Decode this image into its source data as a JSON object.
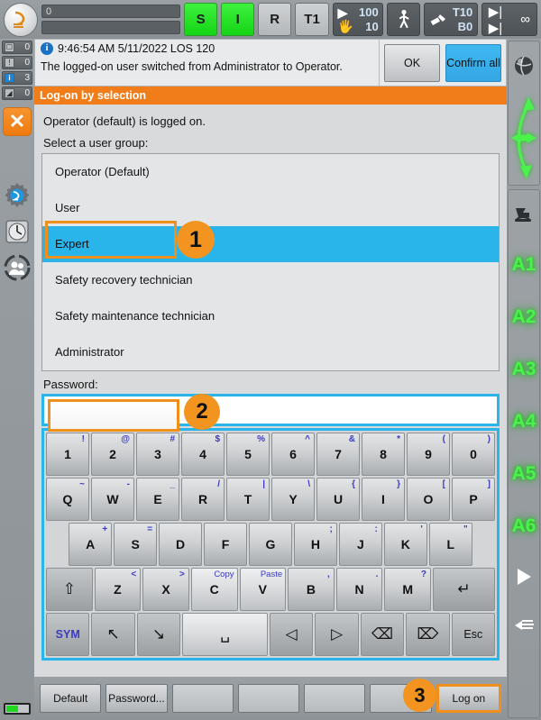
{
  "topbar": {
    "robot_icon": "robot-icon",
    "status_value": "0",
    "keys": [
      {
        "label": "S",
        "style": "green",
        "name": "status-key-s"
      },
      {
        "label": "I",
        "style": "green",
        "name": "status-key-i"
      },
      {
        "label": "R",
        "style": "grey",
        "name": "status-key-r"
      },
      {
        "label": "T1",
        "style": "grey",
        "name": "mode-key-t1"
      }
    ],
    "speed": {
      "program_percent": "100",
      "jog_percent": "10"
    },
    "walk_icon": "walking-person-icon",
    "tool": {
      "tool": "T10",
      "base": "B0"
    },
    "increment_icon": "increment-icon",
    "increment_value": "∞"
  },
  "leftrail": {
    "counters": [
      {
        "icon": "ack-message-icon",
        "count": "0",
        "kind": "ack"
      },
      {
        "icon": "warning-message-icon",
        "count": "0",
        "kind": "warn"
      },
      {
        "icon": "info-message-icon",
        "count": "3",
        "kind": "info"
      },
      {
        "icon": "note-message-icon",
        "count": "0",
        "kind": "note"
      }
    ],
    "close_button": "✕",
    "icons": [
      "gear-robot-icon",
      "clock-icon",
      "user-group-icon"
    ],
    "battery": "battery-indicator"
  },
  "rightrail": {
    "icons_top": [
      "globe-icon",
      "world-coordinates-arrows-icon"
    ],
    "icon_tool": "robot-tool-icon",
    "axes": [
      "A1",
      "A2",
      "A3",
      "A4",
      "A5",
      "A6"
    ],
    "play_icon": "play-triangle-icon",
    "hand_icon": "hand-jog-icon"
  },
  "message": {
    "info_glyph": "i",
    "header": "9:46:54 AM 5/11/2022 LOS 120",
    "body": "The logged-on user switched from Administrator to Operator.",
    "ok_label": "OK",
    "confirm_all_label": "Confirm all"
  },
  "panel": {
    "title": "Log-on by selection",
    "logged_on_text": "Operator (default) is logged on.",
    "select_prompt": "Select a user group:",
    "groups": [
      {
        "label": "Operator (Default)",
        "selected": false
      },
      {
        "label": "User",
        "selected": false
      },
      {
        "label": "Expert",
        "selected": true
      },
      {
        "label": "Safety recovery technician",
        "selected": false
      },
      {
        "label": "Safety maintenance technician",
        "selected": false
      },
      {
        "label": "Administrator",
        "selected": false
      }
    ],
    "password_label": "Password:",
    "password_value": "",
    "password_placeholder": ""
  },
  "callouts": [
    {
      "number": "1",
      "target": "selected-group-row"
    },
    {
      "number": "2",
      "target": "password-field"
    },
    {
      "number": "3",
      "target": "log-on-button"
    }
  ],
  "keyboard": {
    "rows": [
      {
        "name": "number-row",
        "keys": [
          {
            "main": "1",
            "alt": "!",
            "style": "normal"
          },
          {
            "main": "2",
            "alt": "@",
            "style": "normal"
          },
          {
            "main": "3",
            "alt": "#",
            "style": "normal"
          },
          {
            "main": "4",
            "alt": "$",
            "style": "normal"
          },
          {
            "main": "5",
            "alt": "%",
            "style": "normal"
          },
          {
            "main": "6",
            "alt": "^",
            "style": "normal"
          },
          {
            "main": "7",
            "alt": "&",
            "style": "normal"
          },
          {
            "main": "8",
            "alt": "*",
            "style": "normal"
          },
          {
            "main": "9",
            "alt": "(",
            "style": "normal"
          },
          {
            "main": "0",
            "alt": ")",
            "style": "normal"
          }
        ]
      },
      {
        "name": "qwerty-row",
        "keys": [
          {
            "main": "Q",
            "alt": "~",
            "style": "normal"
          },
          {
            "main": "W",
            "alt": "-",
            "style": "normal"
          },
          {
            "main": "E",
            "alt": "_",
            "style": "normal"
          },
          {
            "main": "R",
            "alt": "/",
            "style": "normal"
          },
          {
            "main": "T",
            "alt": "|",
            "style": "normal"
          },
          {
            "main": "Y",
            "alt": "\\",
            "style": "normal"
          },
          {
            "main": "U",
            "alt": "{",
            "style": "normal"
          },
          {
            "main": "I",
            "alt": "}",
            "style": "normal"
          },
          {
            "main": "O",
            "alt": "[",
            "style": "normal"
          },
          {
            "main": "P",
            "alt": "]",
            "style": "normal"
          }
        ]
      },
      {
        "name": "asdf-row",
        "keys": [
          {
            "main": "",
            "alt": "",
            "style": "spacer"
          },
          {
            "main": "A",
            "alt": "+",
            "style": "normal"
          },
          {
            "main": "S",
            "alt": "=",
            "style": "normal"
          },
          {
            "main": "D",
            "alt": "",
            "style": "normal"
          },
          {
            "main": "F",
            "alt": "",
            "style": "normal"
          },
          {
            "main": "G",
            "alt": "",
            "style": "normal"
          },
          {
            "main": "H",
            "alt": ";",
            "style": "normal"
          },
          {
            "main": "J",
            "alt": ":",
            "style": "normal"
          },
          {
            "main": "K",
            "alt": "'",
            "style": "normal"
          },
          {
            "main": "L",
            "alt": "\"",
            "style": "normal"
          },
          {
            "main": "",
            "alt": "",
            "style": "spacer"
          }
        ]
      },
      {
        "name": "zxcv-row",
        "keys": [
          {
            "main": "⇧",
            "alt": "",
            "style": "dark-glyph"
          },
          {
            "main": "Z",
            "alt": "<",
            "style": "normal"
          },
          {
            "main": "X",
            "alt": ">",
            "style": "normal"
          },
          {
            "main": "C",
            "alt": "Copy",
            "style": "word"
          },
          {
            "main": "V",
            "alt": "Paste",
            "style": "word"
          },
          {
            "main": "B",
            "alt": ",",
            "style": "normal"
          },
          {
            "main": "N",
            "alt": ".",
            "style": "normal"
          },
          {
            "main": "M",
            "alt": "?",
            "style": "normal"
          },
          {
            "main": "↵",
            "alt": "",
            "style": "dark-glyph-wide"
          }
        ]
      },
      {
        "name": "bottom-row",
        "keys": [
          {
            "main": "SYM",
            "alt": "",
            "style": "sym"
          },
          {
            "main": "↖",
            "alt": "",
            "style": "dark-glyph"
          },
          {
            "main": "↘",
            "alt": "",
            "style": "dark-glyph"
          },
          {
            "main": "␣",
            "alt": "",
            "style": "space"
          },
          {
            "main": "◁",
            "alt": "",
            "style": "dark-glyph"
          },
          {
            "main": "▷",
            "alt": "",
            "style": "dark-glyph"
          },
          {
            "main": "⌫",
            "alt": "",
            "style": "dark-glyph"
          },
          {
            "main": "⌦",
            "alt": "",
            "style": "dark-glyph"
          },
          {
            "main": "Esc",
            "alt": "",
            "style": "esc"
          }
        ]
      }
    ]
  },
  "bottombar": {
    "buttons": [
      {
        "label": "Default",
        "name": "default-button",
        "highlight": false
      },
      {
        "label": "Password...",
        "name": "password-button",
        "highlight": false
      },
      {
        "label": "",
        "name": "softkey-3",
        "highlight": false
      },
      {
        "label": "",
        "name": "softkey-4",
        "highlight": false
      },
      {
        "label": "",
        "name": "softkey-5",
        "highlight": false
      },
      {
        "label": "",
        "name": "softkey-6",
        "highlight": false
      },
      {
        "label": "Log on",
        "name": "log-on-button",
        "highlight": true
      }
    ]
  },
  "colors": {
    "accent_orange": "#f07d1a",
    "selection_blue": "#29b4ea",
    "callout_orange": "#f2941f",
    "axis_green": "#4cf24c"
  }
}
